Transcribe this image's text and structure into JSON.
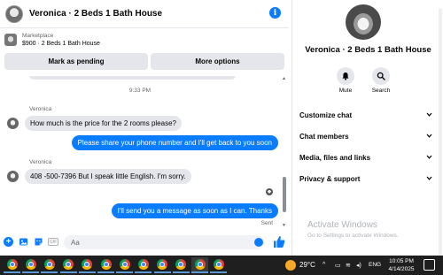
{
  "chat": {
    "title": "Veronica · 2 Beds 1 Bath House",
    "listing": {
      "label": "Marketplace",
      "price_title": "$900 · 2 Beds 1 Bath House",
      "mark_pending": "Mark as pending",
      "more_options": "More options"
    },
    "time_separator": "9:33 PM",
    "messages": [
      {
        "direction": "in",
        "sender": "Veronica",
        "text": "How much is the price for the 2 rooms please?"
      },
      {
        "direction": "out",
        "text": "Please share your phone number and I'll get back to you soon"
      },
      {
        "direction": "in",
        "sender": "Veronica",
        "text": "408 -500-7396   But I speak little English. I'm sorry."
      },
      {
        "direction": "out",
        "text": "I'll send you a message as soon as I can. Thanks"
      }
    ],
    "sent_label": "Sent",
    "composer": {
      "placeholder": "Aa"
    }
  },
  "details": {
    "name": "Veronica · 2 Beds 1 Bath House",
    "actions": [
      {
        "label": "Mute",
        "icon": "bell-icon"
      },
      {
        "label": "Search",
        "icon": "search-icon"
      }
    ],
    "menu": [
      {
        "label": "Customize chat"
      },
      {
        "label": "Chat members"
      },
      {
        "label": "Media, files and links"
      },
      {
        "label": "Privacy & support"
      }
    ],
    "watermark": {
      "title": "Activate Windows",
      "subtitle": "Go to Settings to activate Windows."
    }
  },
  "taskbar": {
    "app_count": 12,
    "temperature": "29°C",
    "language": "ENG",
    "time": "10:05 PM",
    "date": "4/14/2025"
  },
  "colors": {
    "accent": "#0a7cff",
    "bubble_in": "#e4e6eb",
    "taskbar": "#1f1f1f"
  }
}
